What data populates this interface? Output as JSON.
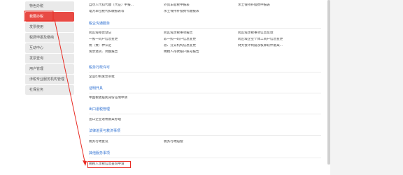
{
  "sidebar": {
    "items": [
      {
        "label": "特色办税",
        "active": false
      },
      {
        "label": "我要办税",
        "active": true
      },
      {
        "label": "发票使用",
        "active": false
      },
      {
        "label": "税费申报及缴纳",
        "active": false
      },
      {
        "label": "互动中心",
        "active": false
      },
      {
        "label": "发票查询",
        "active": false
      },
      {
        "label": "用户管理",
        "active": false
      },
      {
        "label": "涉税专业服务机构管理",
        "active": false
      },
      {
        "label": "社保业务",
        "active": false
      }
    ]
  },
  "main": {
    "top_rows": [
      [
        "自然人代扣代缴（代征）申报...",
        "外贸车船税申报表",
        "水土保持补偿费申报表"
      ],
      [
        "电力单位税代扣缴报表等",
        "水土保持补偿费代缴报表",
        ""
      ]
    ],
    "sections": [
      {
        "title": "税企沟通服务",
        "rows": [
          [
            "跨区域经营登记",
            "跨区域涉税事项报告",
            "跨区域涉税事项信息反馈"
          ],
          [
            "一照一码户信息变更",
            "非一照一码户信息变更",
            "跨区域企业个体工商户信息变更"
          ],
          [
            "税（费）种认定",
            "总、分支机构信息变更",
            "财务会计制度及核算软件备案..."
          ],
          [
            "发票退货、调整报告",
            "纳税人存款账户账号报告",
            ""
          ]
        ]
      },
      {
        "title": "税务行政许可",
        "rows": [
          [
            "企业印制发票审批",
            "",
            ""
          ]
        ]
      },
      {
        "title": "证明开具",
        "rows": [
          [
            "中国税收居民身份证明申请",
            "",
            ""
          ]
        ]
      },
      {
        "title": "出口退税管理",
        "rows": [
          [
            "出口企业退税备案办理",
            "",
            ""
          ]
        ]
      },
      {
        "title": "法律追责与救济事项",
        "rows": [
          [
            "税务行政复议",
            "税务行政赔偿",
            ""
          ]
        ]
      },
      {
        "title": "其他服务事项",
        "rows": [
          [
            "纳税人涉税信息查询申请",
            "",
            ""
          ]
        ]
      }
    ]
  },
  "colors": {
    "accent_red": "#e84a44",
    "link_blue": "#2d6fd1",
    "annotation_red": "#e82c24"
  }
}
